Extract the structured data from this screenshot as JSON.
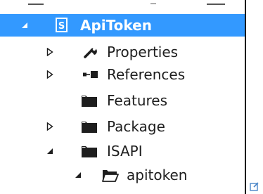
{
  "tree": {
    "root": {
      "label": "ApiToken",
      "icon": "csharp-project-icon",
      "state": "expanded",
      "selected": true
    },
    "items": [
      {
        "label": "Properties",
        "icon": "wrench-icon",
        "state": "collapsed"
      },
      {
        "label": "References",
        "icon": "references-icon",
        "state": "collapsed"
      },
      {
        "label": "Features",
        "icon": "folder-icon",
        "state": "none"
      },
      {
        "label": "Package",
        "icon": "folder-icon",
        "state": "collapsed"
      },
      {
        "label": "ISAPI",
        "icon": "folder-icon",
        "state": "expanded"
      },
      {
        "label": "apitoken",
        "icon": "open-folder-icon",
        "state": "expanded"
      }
    ]
  },
  "colors": {
    "selection": "#3399ff",
    "text": "#1e1e1e",
    "icon": "#1e1e1e",
    "panel_border": "#1a1a1a",
    "corner_mark": "#4a86c8"
  }
}
